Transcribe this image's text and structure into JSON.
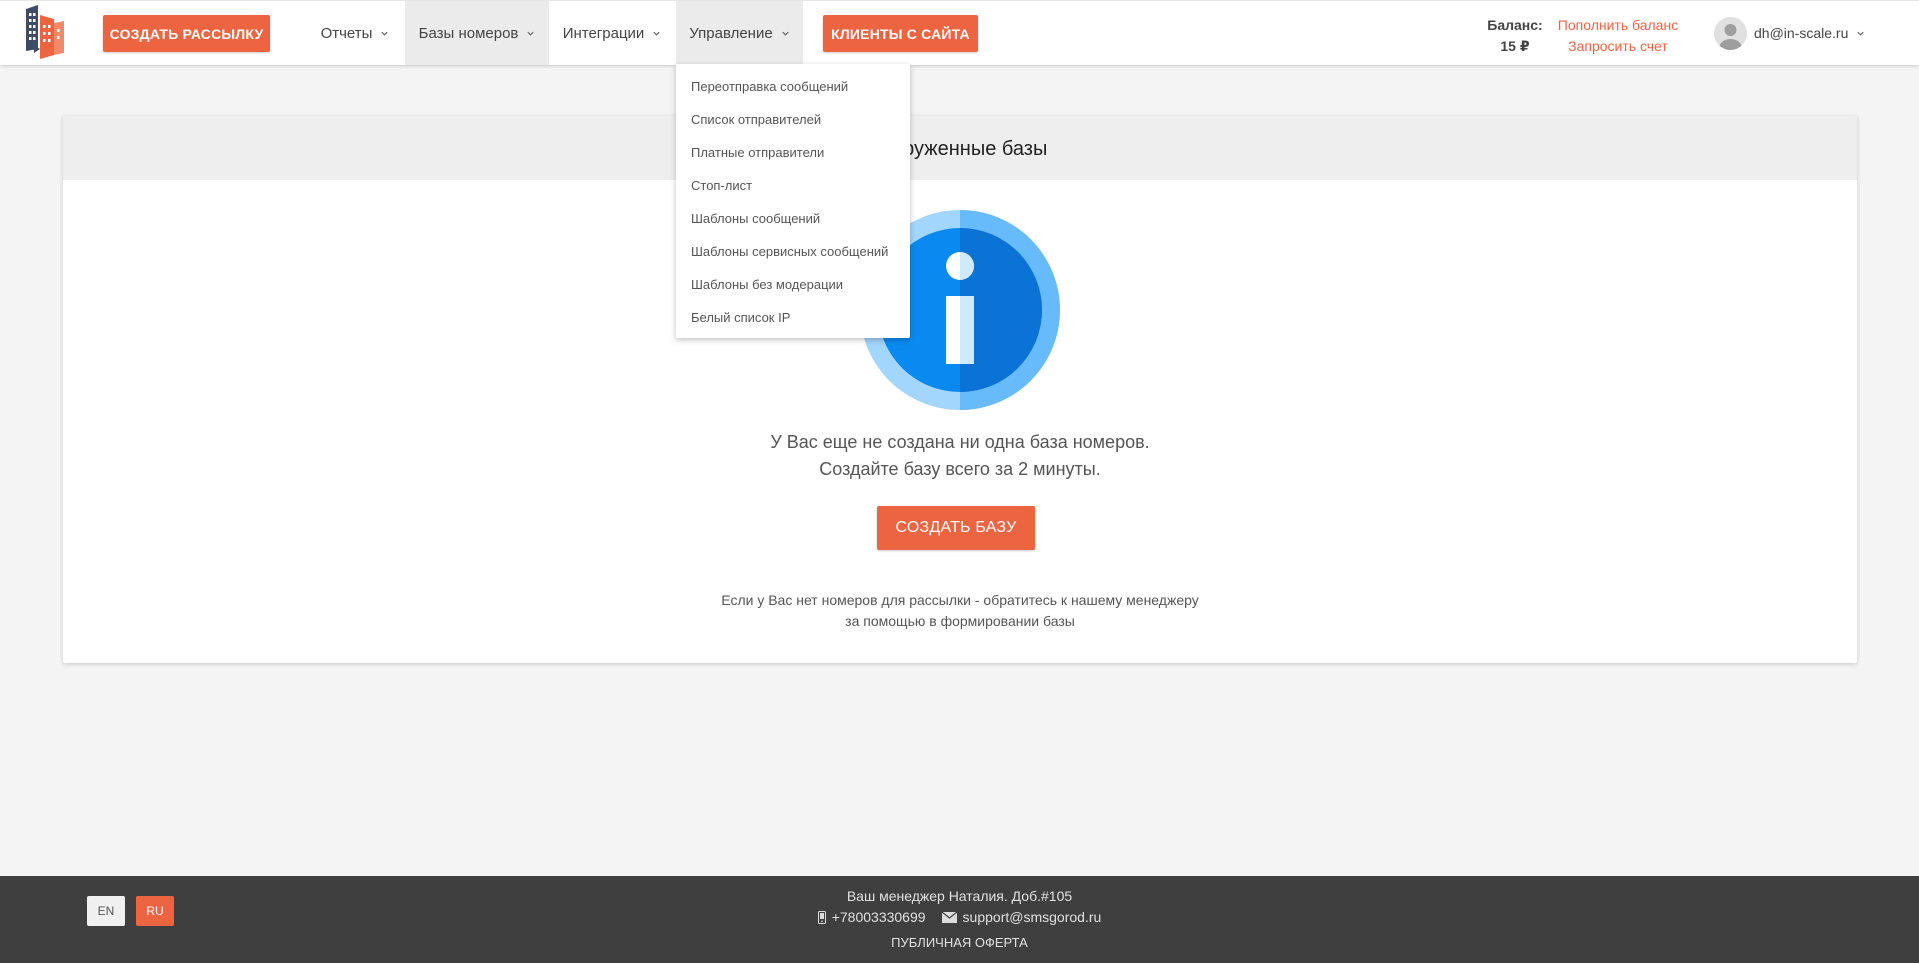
{
  "header": {
    "create_mailing_label": "Создать рассылку",
    "nav": {
      "reports": "Отчеты",
      "bases": "Базы номеров",
      "integrations": "Интеграции",
      "manage": "Управление"
    },
    "clients_label": "Клиенты с сайта",
    "balance_label": "Баланс:",
    "balance_value": "15 ₽",
    "topup_label": "Пополнить баланс",
    "invoice_label": "Запросить счет",
    "user_email": "dh@in-scale.ru"
  },
  "dropdown": {
    "items": [
      "Переотправка сообщений",
      "Список отправителей",
      "Платные отправители",
      "Стоп-лист",
      "Шаблоны сообщений",
      "Шаблоны сервисных сообщений",
      "Шаблоны без модерации",
      "Белый список IP"
    ]
  },
  "card": {
    "title": "Загруженные базы",
    "empty_line1": "У Вас еще не создана ни одна база номеров.",
    "empty_line2": "Создайте базу всего за 2 минуты.",
    "create_base_label": "СОЗДАТЬ БАЗУ",
    "help_line1": "Если у Вас нет номеров для рассылки - обратитесь к нашему менеджеру",
    "help_line2": "за помощью в формировании базы"
  },
  "footer": {
    "lang_en": "EN",
    "lang_ru": "RU",
    "manager": "Ваш менеджер Наталия. Доб.#105",
    "phone": "+78003330699",
    "email": "support@smsgorod.ru",
    "offer": "Публичная оферта"
  },
  "colors": {
    "accent": "#ed6440",
    "info_blue": "#0a8af0",
    "info_blue_dark": "#0b72d6",
    "info_ring": "#68bbfb",
    "info_ring_light": "#a3d6fc",
    "footer_bg": "#3f3f3f"
  }
}
